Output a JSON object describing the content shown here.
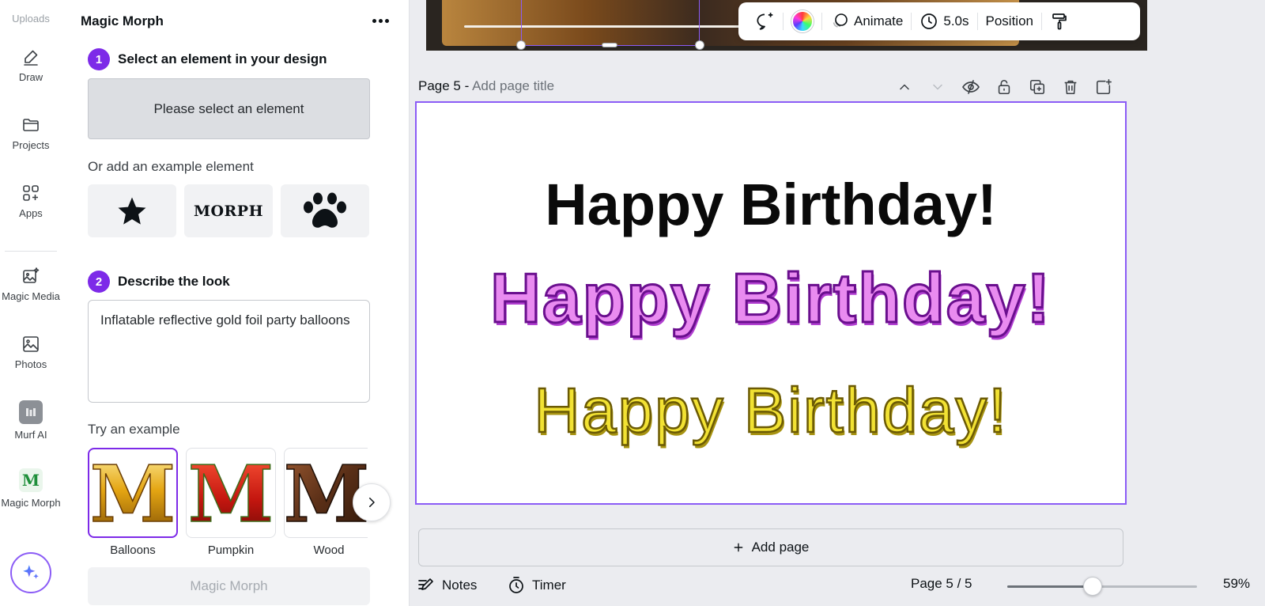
{
  "rail": {
    "uploads_label": "Uploads",
    "items": [
      {
        "label": "Draw",
        "icon": "draw-icon"
      },
      {
        "label": "Projects",
        "icon": "folder-icon"
      },
      {
        "label": "Apps",
        "icon": "apps-icon"
      },
      {
        "label": "Magic Media",
        "icon": "magic-media-icon"
      },
      {
        "label": "Photos",
        "icon": "photos-icon"
      },
      {
        "label": "Murf AI",
        "icon": "murf-ai-icon"
      },
      {
        "label": "Magic Morph",
        "icon": "magic-morph-icon"
      }
    ],
    "assistant_icon": "sparkle-icon"
  },
  "panel": {
    "title": "Magic Morph",
    "step1": {
      "number": "1",
      "label": "Select an element in your design"
    },
    "select_placeholder": "Please select an element",
    "example_label": "Or add an example element",
    "example_elements": [
      {
        "kind": "star",
        "icon": "star-icon"
      },
      {
        "kind": "text",
        "text": "MORPH"
      },
      {
        "kind": "paw",
        "icon": "paw-icon"
      }
    ],
    "step2": {
      "number": "2",
      "label": "Describe the look"
    },
    "description": "Inflatable reflective gold foil party balloons",
    "try_label": "Try an example",
    "try_examples": [
      {
        "label": "Balloons",
        "letter": "M",
        "selected": true
      },
      {
        "label": "Pumpkin",
        "letter": "M",
        "selected": false
      },
      {
        "label": "Wood",
        "letter": "M",
        "selected": false
      }
    ],
    "submit_label": "Magic Morph"
  },
  "toolbar": {
    "animate_label": "Animate",
    "duration_label": "5.0s",
    "position_label": "Position"
  },
  "page": {
    "header_prefix": "Page 5 -",
    "title_placeholder": "Add page title",
    "texts": [
      "Happy Birthday!",
      "Happy Birthday!",
      "Happy Birthday!"
    ]
  },
  "add_page_label": "Add page",
  "bottom": {
    "notes_label": "Notes",
    "timer_label": "Timer",
    "page_indicator": "Page 5 / 5",
    "zoom_label": "59%",
    "zoom_fraction": 0.45
  },
  "colors": {
    "accent": "#7d2ae8",
    "selection": "#8b5cf6"
  }
}
